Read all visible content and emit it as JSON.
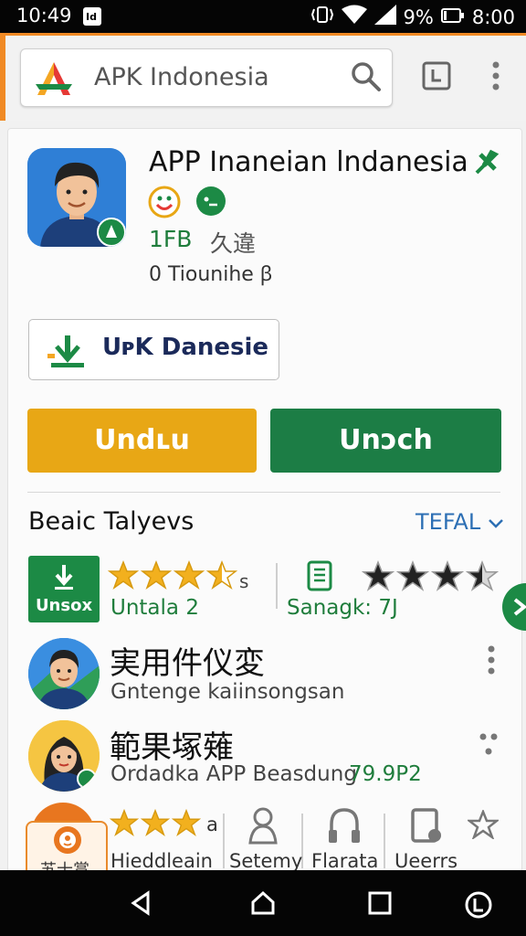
{
  "status_bar": {
    "time": "10:49",
    "icons": [
      "notification-icon",
      "vibrate-icon",
      "wifi-icon",
      "signal-icon",
      "battery-icon"
    ],
    "battery": "9%",
    "clock": "8:00"
  },
  "top_bar": {
    "search_query": "APK Indonesia",
    "icons": [
      "store-logo-icon",
      "search-icon",
      "history-icon",
      "more-vert-icon"
    ]
  },
  "app": {
    "title": "APP Inaneian lndanesia",
    "size": "1FB",
    "category": "久違",
    "subtitle": "0 Tiounihe ꞵ",
    "outline_button_label": "UᴘK Danesie",
    "primary_button_label": "Undʟu",
    "secondary_button_label": "Unↄch"
  },
  "section": {
    "title": "Beaic Talyevs",
    "link_label": "TEFAL"
  },
  "stats": {
    "box_label": "Unsox",
    "rating_suffix": "s",
    "rating_label": "Untala 2",
    "doc_label": "Sanagk: 7J",
    "rating_a": 3.5,
    "rating_b": 3.5
  },
  "list": [
    {
      "title": "実用件仪変",
      "subtitle": "Gntenge kaiinsongsan",
      "price": ""
    },
    {
      "title": "範果塚薙",
      "subtitle": "Ordadka APP Beasdung",
      "price": "79.9P2"
    }
  ],
  "bottom_strip": {
    "promo_label": "苏士賞",
    "rating_suffix": "a",
    "items": [
      "Hieddleain",
      "Setemy",
      "Flarata",
      "Ueerrs"
    ]
  },
  "colors": {
    "accent_orange": "#f08a24",
    "button_yellow": "#e8a715",
    "button_green": "#1c7d45",
    "link_blue": "#2c6fb4"
  }
}
